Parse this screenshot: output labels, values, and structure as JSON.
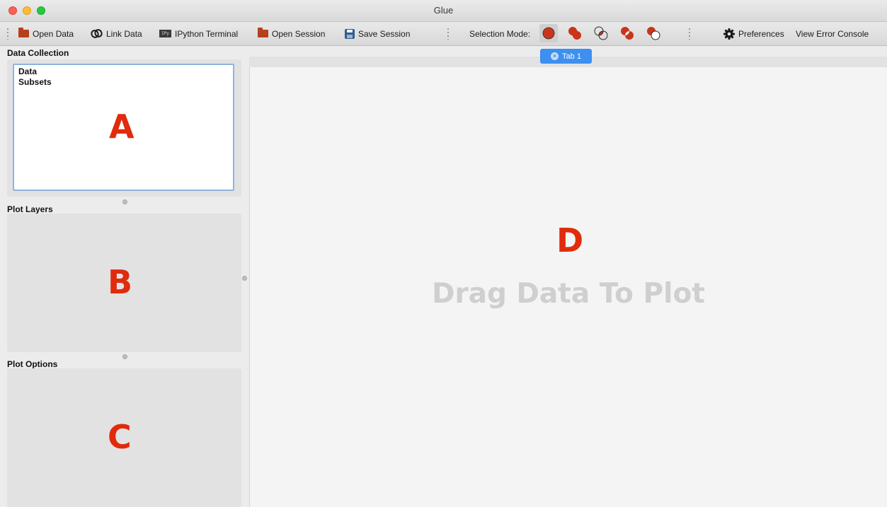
{
  "window": {
    "title": "Glue"
  },
  "toolbar": {
    "open_data": "Open Data",
    "link_data": "Link Data",
    "ipython": "IPython Terminal",
    "ipython_icon_text": "IPy",
    "open_session": "Open Session",
    "save_session": "Save Session",
    "selection_mode_label": "Selection Mode:",
    "preferences": "Preferences",
    "error_console": "View Error Console"
  },
  "icons": {
    "open_data": "folder-icon",
    "link_data": "link-icon",
    "ipython": "terminal-icon",
    "open_session": "folder-icon",
    "save_session": "save-icon",
    "preferences": "gear-icon",
    "selection_modes": [
      "replace-mode-icon",
      "or-mode-icon",
      "and-mode-icon",
      "xor-mode-icon",
      "and-not-mode-icon"
    ]
  },
  "selection_modes": {
    "active_index": 0
  },
  "left": {
    "data_collection": {
      "label": "Data Collection",
      "items": [
        "Data",
        "Subsets"
      ],
      "marker": "A"
    },
    "plot_layers": {
      "label": "Plot Layers",
      "marker": "B"
    },
    "plot_options": {
      "label": "Plot Options",
      "marker": "C"
    }
  },
  "main": {
    "tab_label": "Tab 1",
    "marker": "D",
    "placeholder": "Drag Data To Plot"
  },
  "colors": {
    "accent": "#3d8ff0",
    "selection_red": "#c9351a",
    "marker_red": "#e02b0c"
  }
}
